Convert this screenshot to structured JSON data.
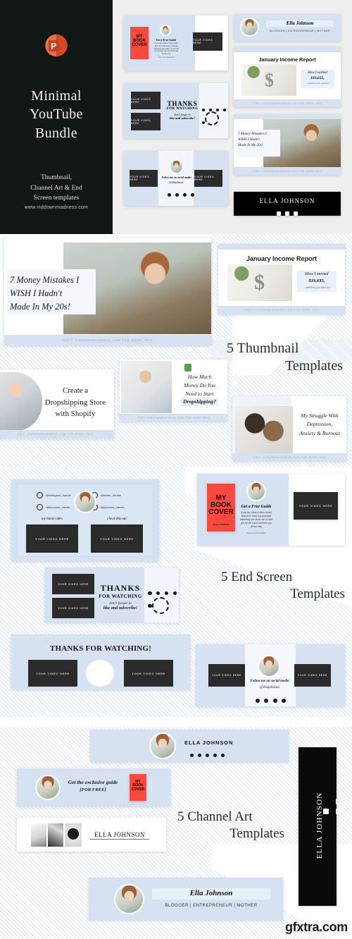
{
  "cover": {
    "logo": "powerpoint-icon",
    "title": "Minimal\nYouTube\nBundle",
    "title_line1": "Minimal",
    "title_line2": "YouTube",
    "title_line3": "Bundle",
    "subtitle_line1": "Thumbnail,",
    "subtitle_line2": "Channel Art & End",
    "subtitle_line3": "Screen templates",
    "url": "www.viddownmadness.com",
    "bg_color": "#101714",
    "accent_color": "#d24726"
  },
  "section_headings": {
    "thumbnail": {
      "line1": "5 Thumbnail",
      "line2": "Templates"
    },
    "endscreen": {
      "line1": "5 End Screen",
      "line2": "Templates"
    },
    "channelart": {
      "line1": "5 Channel Art",
      "line2": "Templates"
    }
  },
  "brand": {
    "name_caps": "ELLA JOHNSON",
    "name_script": "Ella Johnson",
    "tagline": "BLOGGER | ENTREPRENEUR | MOTHER",
    "handle": "@ellajohnson",
    "visit_bar": "VISIT: VIDDOWNMADNESS.COM FOR MORE INFO",
    "red": "#fb4a3d",
    "blue_panel": "#d6e2f2",
    "dark_panel": "#2b2b2b"
  },
  "placeholders": {
    "video": "YOUR VIDEO HERE"
  },
  "thumbnails": [
    {
      "id": "money-mistakes",
      "title_line1": "7 Money Mistakes I",
      "title_line2": "WISH I Hadn't",
      "title_line3": "Made In My 20s!",
      "title_bold_tail": "20s!",
      "footer": "VISIT: VIDDOWNMADNESS.COM FOR MORE INFO"
    },
    {
      "id": "january-income-report",
      "title": "January Income Report",
      "callout_line1": "How I earned",
      "callout_line2": "$19,635,",
      "callout_line3": "...and how you can too!",
      "footer": "VISIT: VIDDOWNMADNESS.COM FOR MORE INFO"
    },
    {
      "id": "dropshipping-shopify",
      "title_line1": "Create a",
      "title_line2": "Dropshipping Store",
      "title_line3": "with Shopify",
      "footer": "VISIT: VIDDOWNMADNESS.COM FOR MORE INFO"
    },
    {
      "id": "how-much-money-dropshipping",
      "title_line1": "How Much",
      "title_line2": "Money Do You",
      "title_line3": "Need to Start",
      "title_line4": "Dropshipping?",
      "footer": "VISIT: VIDDOWNMADNESS.COM FOR MORE INFO"
    },
    {
      "id": "depression-anxiety-burnout",
      "title_line1": "My Struggle With",
      "title_line2": "Depression,",
      "title_line3": "Anxiety & Burnout",
      "footer": "VISIT: VIDDOWNMADNESS.COM FOR MORE INFO"
    }
  ],
  "endscreens": [
    {
      "id": "book-cover-free-guide",
      "book_line1": "MY",
      "book_line2": "BOOK",
      "book_line3": "COVER",
      "book_byline": "BY ELLA JOHNSON",
      "heading": "Get a Free Guide",
      "body": "If you are tired of other books that don't have any practical takeaway just allow me to hold you by the hand and took you all the way",
      "link_note": "Link in the description",
      "video_label": "YOUR VIDEO HERE"
    },
    {
      "id": "thanks-for-watching",
      "heading_line1": "THANKS",
      "heading_line2": "FOR WATCHING",
      "sub_line1": "don't forget to",
      "sub_line2": "like and subscribe!",
      "video_label": "YOUR VIDEO HERE",
      "social_count": 5
    },
    {
      "id": "social-links-grid",
      "left_label": "my latest video",
      "right_label": "check this out",
      "socials": [
        {
          "icon": "instagram-icon",
          "handle": "@instagram_handle"
        },
        {
          "icon": "twitter-icon",
          "handle": "@twitter_handle"
        },
        {
          "icon": "facebook-icon",
          "handle": "@facebook_handle"
        },
        {
          "icon": "pinterest-icon",
          "handle": "@pinterest_handle"
        }
      ],
      "video_label": "YOUR VIDEO HERE"
    },
    {
      "id": "thanks-for-watching-banner",
      "heading": "THANKS FOR WATCHING!",
      "video_label": "YOUR VIDEO HERE"
    },
    {
      "id": "follow-me-social",
      "line1": "Follow me on social media",
      "line2": "@ellajohnson",
      "video_label": "YOUR VIDEO HERE",
      "social_count": 4
    }
  ],
  "channel_arts": [
    {
      "id": "ella-johnson-dots",
      "name": "ELLA JOHNSON",
      "social_count": 5
    },
    {
      "id": "exclusive-guide",
      "line1": "Get the exclusive guide",
      "line2": "[FOR FREE]",
      "book_line1": "MY",
      "book_line2": "BOOK",
      "book_line3": "COVER"
    },
    {
      "id": "photo-strip-name",
      "name": "ELLA JOHNSON"
    },
    {
      "id": "vertical-dark-banner",
      "name": "ELLA JOHNSON",
      "socials": [
        "instagram-icon",
        "twitter-icon",
        "facebook-icon"
      ]
    },
    {
      "id": "ella-johnson-tagline",
      "name": "Ella Johnson",
      "tagline": "BLOGGER | ENTREPRENEUR | MOTHER"
    }
  ],
  "watermark": {
    "text": "gfxtra.com"
  }
}
